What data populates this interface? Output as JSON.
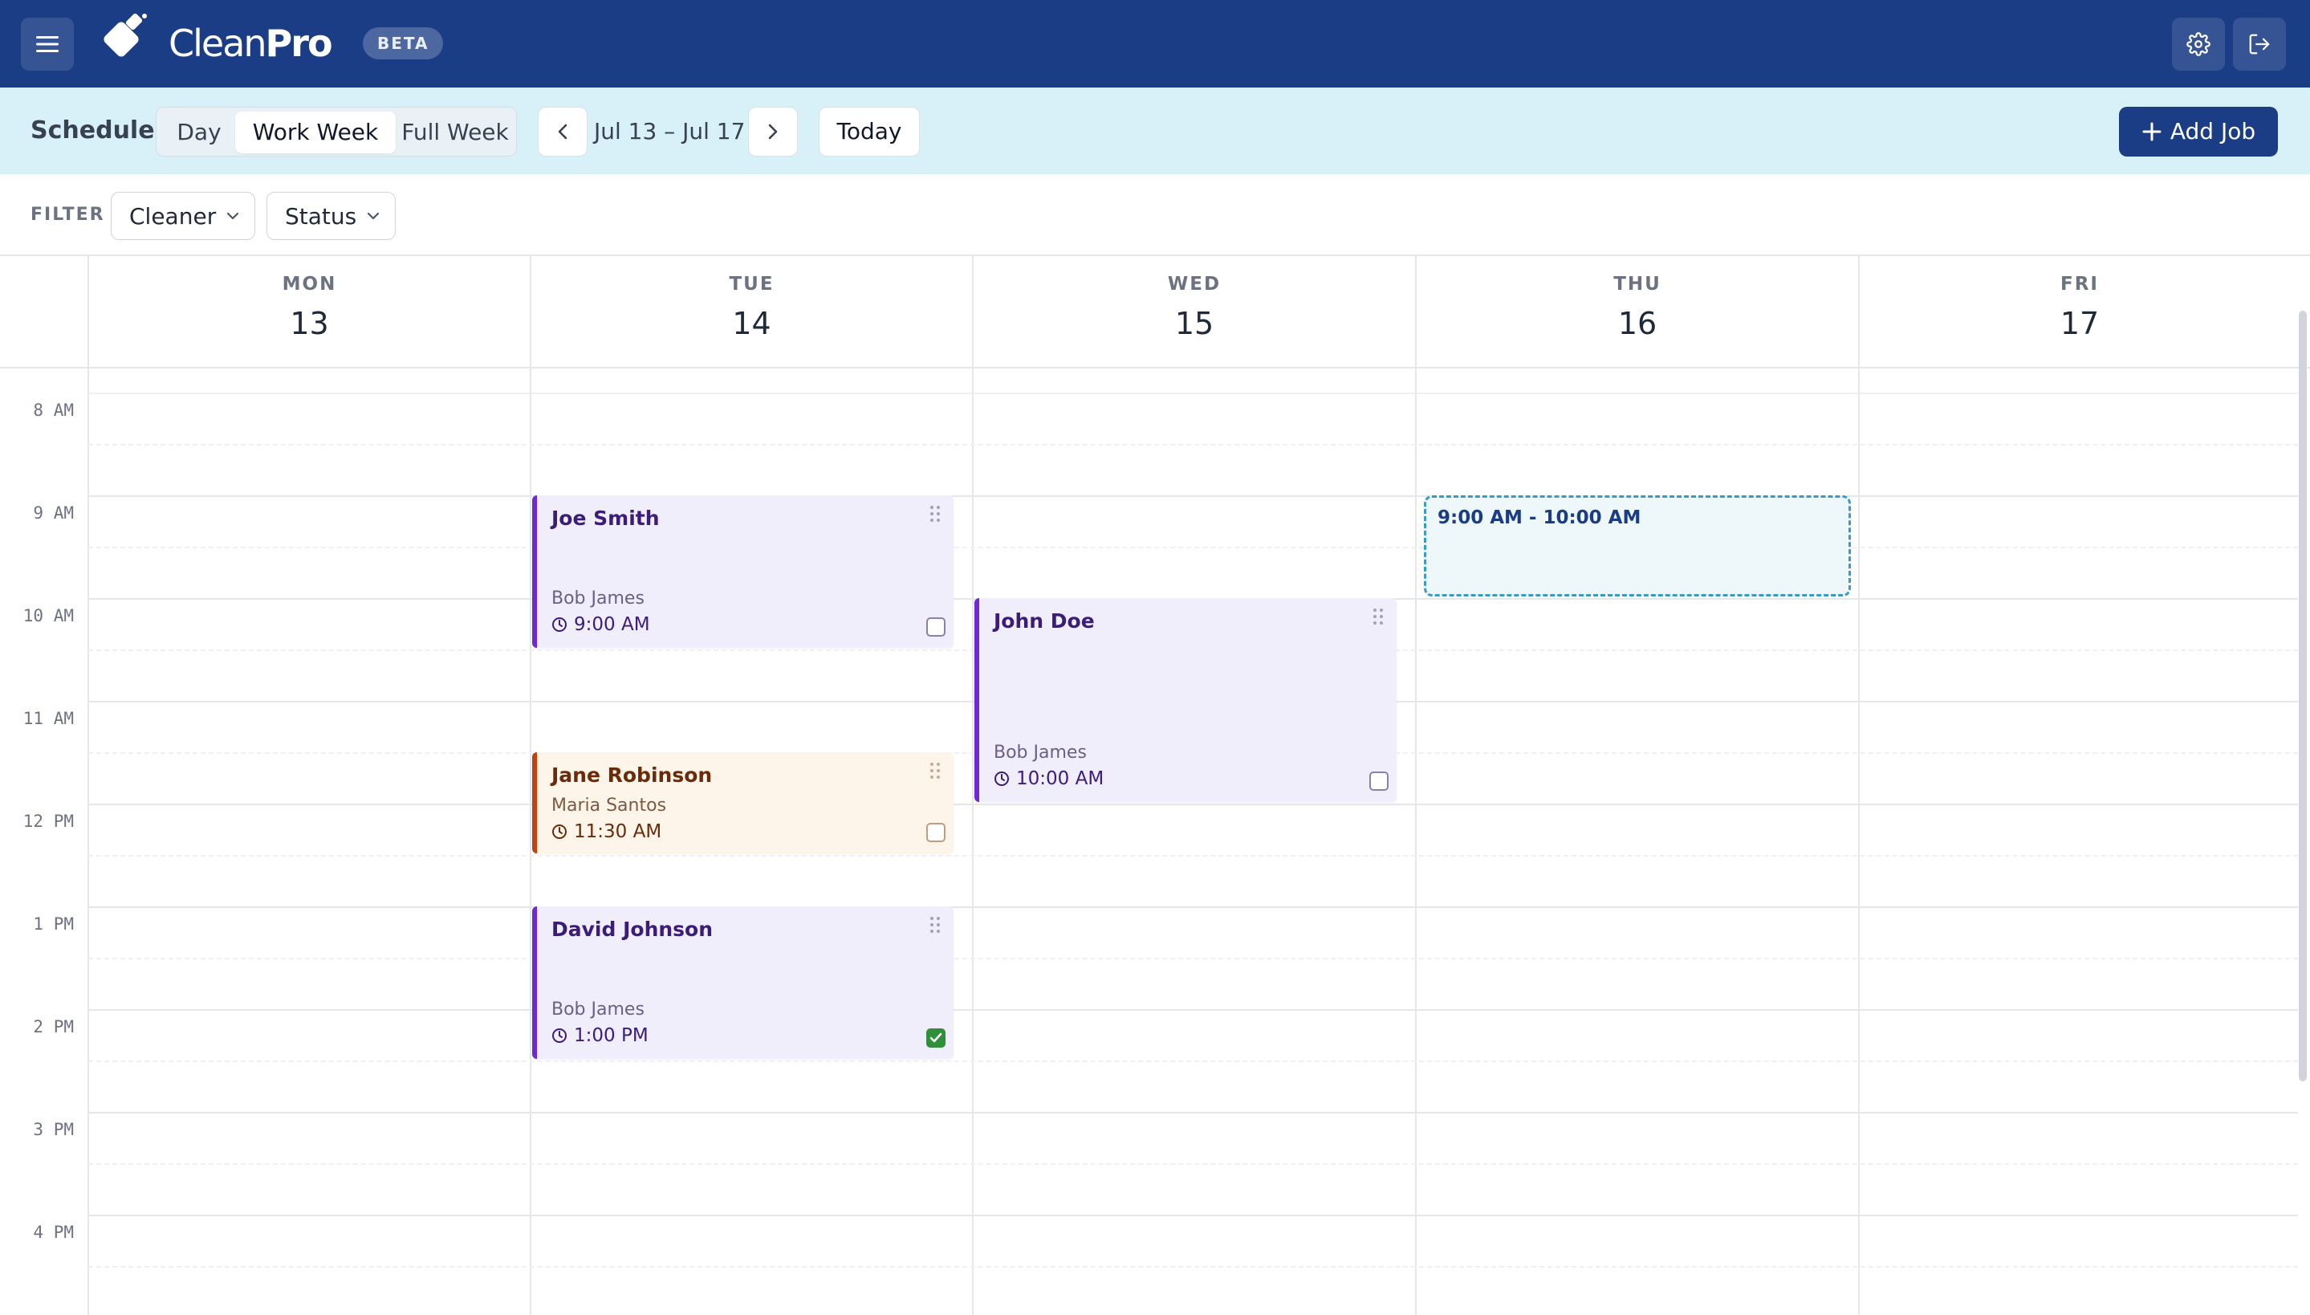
{
  "app": {
    "brand_part1": "Clean",
    "brand_part2": "Pro",
    "badge": "BETA",
    "menu_icon": "hamburger-icon",
    "settings_icon": "gear-icon",
    "logout_icon": "logout-icon",
    "accent": "#1b3d86"
  },
  "toolbar": {
    "title": "Schedule",
    "views": [
      "Day",
      "Work Week",
      "Full Week"
    ],
    "active_view": "Work Week",
    "range": "Jul 13 – Jul 17",
    "today_label": "Today",
    "add_label": "Add Job"
  },
  "filters": {
    "label": "FILTER",
    "cleaner": "Cleaner",
    "status": "Status"
  },
  "calendar": {
    "days": [
      {
        "name": "MON",
        "num": "13"
      },
      {
        "name": "TUE",
        "num": "14"
      },
      {
        "name": "WED",
        "num": "15"
      },
      {
        "name": "THU",
        "num": "16"
      },
      {
        "name": "FRI",
        "num": "17"
      }
    ],
    "hours": [
      "8 AM",
      "9 AM",
      "10 AM",
      "11 AM",
      "12 PM",
      "1 PM",
      "2 PM",
      "3 PM",
      "4 PM"
    ],
    "events": [
      {
        "title": "Joe Smith",
        "cleaner": "Bob James",
        "time": "9:00 AM",
        "done": false
      },
      {
        "title": "Jane Robinson",
        "cleaner": "Maria Santos",
        "time": "11:30 AM",
        "done": false
      },
      {
        "title": "David Johnson",
        "cleaner": "Bob James",
        "time": "1:00 PM",
        "done": true
      },
      {
        "title": "John Doe",
        "cleaner": "Bob James",
        "time": "10:00 AM",
        "done": false
      }
    ],
    "selection": "9:00 AM - 10:00 AM"
  }
}
